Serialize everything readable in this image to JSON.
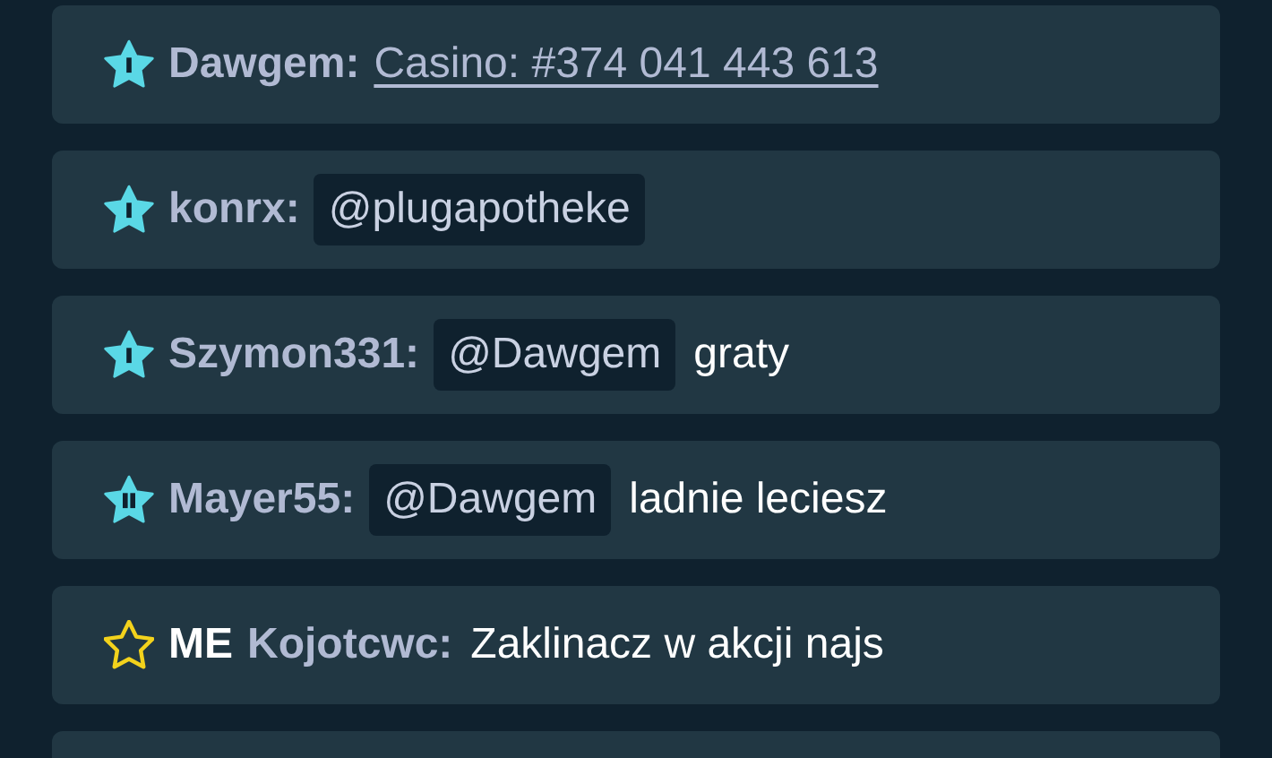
{
  "messages": [
    {
      "kind": "vip1",
      "user": "Dawgem:",
      "parts": [
        {
          "kind": "link",
          "text": "Casino: #374 041 443 613"
        }
      ]
    },
    {
      "kind": "vip1",
      "user": "konrx:",
      "parts": [
        {
          "kind": "mention",
          "text": "@plugapotheke"
        }
      ]
    },
    {
      "kind": "vip1",
      "user": "Szymon331:",
      "parts": [
        {
          "kind": "mention",
          "text": "@Dawgem"
        },
        {
          "kind": "text",
          "text": "graty"
        }
      ]
    },
    {
      "kind": "vip2",
      "user": "Mayer55:",
      "parts": [
        {
          "kind": "mention",
          "text": "@Dawgem"
        },
        {
          "kind": "text",
          "text": "ladnie leciesz"
        }
      ]
    },
    {
      "kind": "own",
      "tag": "ME",
      "user": "Kojotcwc:",
      "parts": [
        {
          "kind": "text",
          "text": "Zaklinacz w akcji najs"
        }
      ]
    },
    {
      "kind": "empty"
    }
  ]
}
